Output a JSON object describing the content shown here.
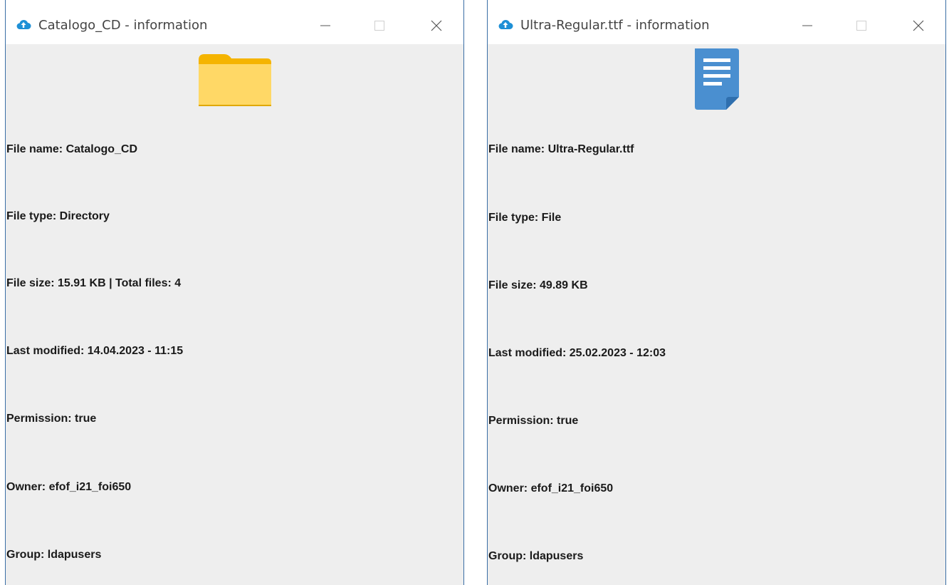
{
  "windows": [
    {
      "title": "Catalogo_CD - information",
      "icon": "folder-icon",
      "fields": [
        {
          "text": "File name: Catalogo_CD"
        },
        {
          "text": "File type: Directory"
        },
        {
          "text": "File size: 15.91 KB | Total files: 4"
        },
        {
          "text": "Last modified: 14.04.2023 - 11:15"
        },
        {
          "text": "Permission: true"
        },
        {
          "text": "Owner: efof_i21_foi650"
        },
        {
          "text": "Group: ldapusers"
        }
      ]
    },
    {
      "title": "Ultra-Regular.ttf - information",
      "icon": "document-icon",
      "fields": [
        {
          "text": "File name: Ultra-Regular.ttf"
        },
        {
          "text": "File type: File"
        },
        {
          "text": "File size: 49.89 KB"
        },
        {
          "text": "Last modified: 25.02.2023 - 12:03"
        },
        {
          "text": "Permission: true"
        },
        {
          "text": "Owner: efof_i21_foi650"
        },
        {
          "text": "Group: ldapusers"
        }
      ]
    }
  ],
  "colors": {
    "accent": "#1e90d6",
    "folder": "#ffd866",
    "folder_tab": "#f5b400",
    "document": "#4a8fd0"
  }
}
